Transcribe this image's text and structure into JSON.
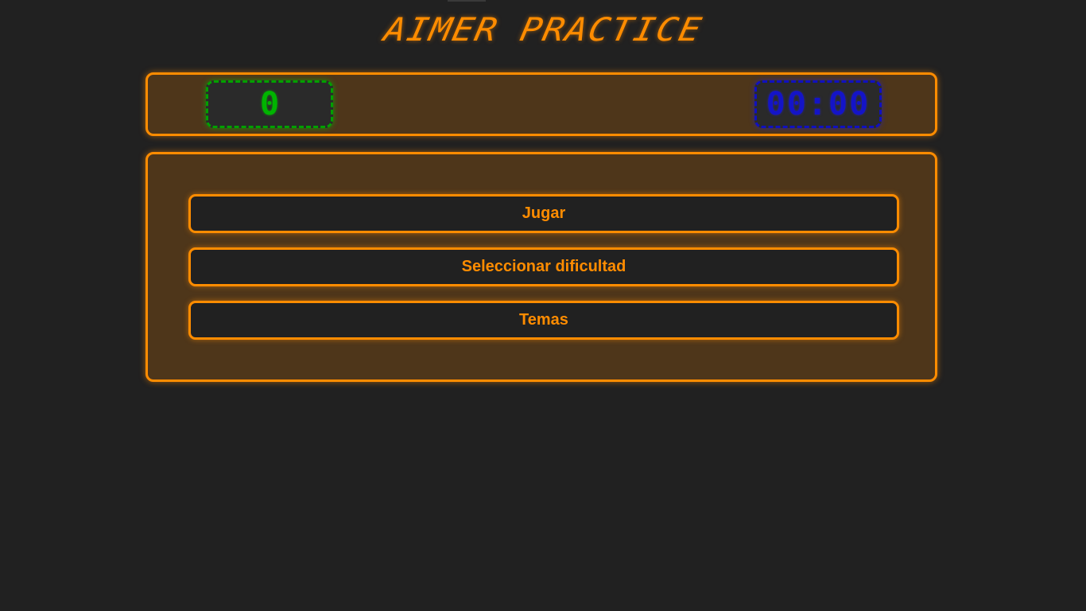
{
  "app": {
    "title": "AIMER PRACTICE"
  },
  "stats": {
    "score": "0",
    "timer": "00:00"
  },
  "menu": {
    "items": [
      {
        "label": "Jugar"
      },
      {
        "label": "Seleccionar dificultad"
      },
      {
        "label": "Temas"
      }
    ]
  },
  "colors": {
    "accent": "#ff8c00",
    "background": "#212121",
    "panel": "#4e361a",
    "score": "#00b400",
    "timer": "#1414c8"
  }
}
